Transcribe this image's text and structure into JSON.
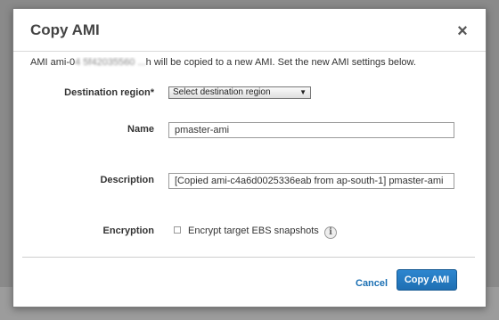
{
  "dialog": {
    "title": "Copy AMI",
    "close_glyph": "×",
    "intro_prefix": "AMI ami-0",
    "intro_obscured": "4 5f42035560 ...",
    "intro_suffix": "h will be copied to a new AMI. Set the new AMI settings below."
  },
  "form": {
    "destination_label": "Destination region*",
    "destination_value": "Select destination region",
    "name_label": "Name",
    "name_value": "pmaster-ami",
    "description_label": "Description",
    "description_value": "[Copied ami-c4a6d0025336eab from ap-south-1] pmaster-ami",
    "encryption_label": "Encryption",
    "encrypt_checkbox_label": "Encrypt target EBS snapshots",
    "encrypt_checked": false
  },
  "footer": {
    "cancel_label": "Cancel",
    "submit_label": "Copy AMI"
  },
  "colors": {
    "accent": "#1e6fb3",
    "link": "#1a6fb3"
  }
}
